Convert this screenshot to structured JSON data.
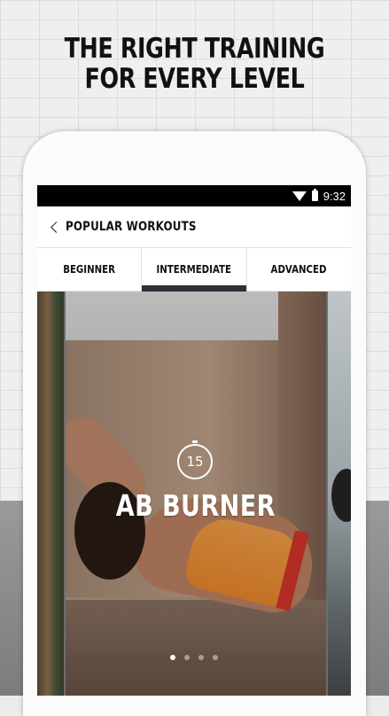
{
  "promo": {
    "title_line1": "THE RIGHT TRAINING",
    "title_line2": "FOR EVERY LEVEL"
  },
  "status_bar": {
    "time": "9:32",
    "icons": [
      "wifi-icon",
      "battery-icon"
    ]
  },
  "app_bar": {
    "back_icon": "chevron-left-icon",
    "title": "POPULAR WORKOUTS"
  },
  "tabs": [
    {
      "label": "BEGINNER",
      "active": false
    },
    {
      "label": "INTERMEDIATE",
      "active": true
    },
    {
      "label": "ADVANCED",
      "active": false
    }
  ],
  "workout_card": {
    "timer_minutes": "15",
    "timer_icon": "stopwatch-icon",
    "name": "AB BURNER"
  },
  "pager": {
    "count": 4,
    "active_index": 0
  }
}
